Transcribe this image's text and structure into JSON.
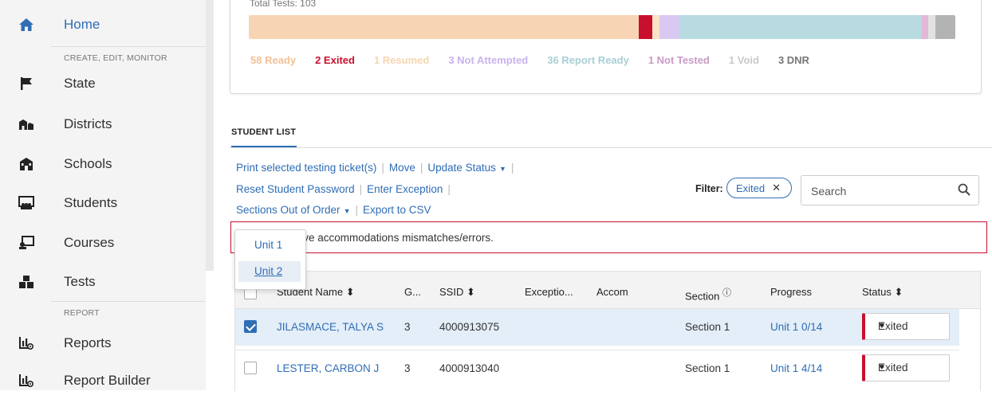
{
  "sidebar": {
    "items": [
      {
        "label": "Home",
        "icon": "home-icon"
      },
      {
        "label": "State",
        "icon": "flag-icon"
      },
      {
        "label": "Districts",
        "icon": "districts-icon"
      },
      {
        "label": "Schools",
        "icon": "school-icon"
      },
      {
        "label": "Students",
        "icon": "students-icon"
      },
      {
        "label": "Courses",
        "icon": "courses-icon"
      },
      {
        "label": "Tests",
        "icon": "tests-icon"
      },
      {
        "label": "Reports",
        "icon": "reports-icon"
      },
      {
        "label": "Report Builder",
        "icon": "report-builder-icon"
      }
    ],
    "sections": {
      "create": "CREATE, EDIT, MONITOR",
      "report": "REPORT"
    }
  },
  "summary": {
    "total_label": "Total Tests: 103",
    "segments": [
      {
        "label": "58 Ready",
        "count": 58,
        "color": "#f7d5b4"
      },
      {
        "label": "2 Exited",
        "count": 2,
        "color": "#c8102e"
      },
      {
        "label": "1 Resumed",
        "count": 1,
        "color": "#fbe3c6"
      },
      {
        "label": "3 Not Attempted",
        "count": 3,
        "color": "#d9c8f2"
      },
      {
        "label": "36 Report Ready",
        "count": 36,
        "color": "#b7dbe0"
      },
      {
        "label": "1 Not Tested",
        "count": 1,
        "color": "#e2b8d6"
      },
      {
        "label": "1 Void",
        "count": 1,
        "color": "#e2e2e2"
      },
      {
        "label": "3 DNR",
        "count": 3,
        "color": "#b3b3b3"
      }
    ],
    "legend_colors": [
      "#f2c196",
      "#c8102e",
      "#f5d6b0",
      "#c9b3ee",
      "#a8cfd5",
      "#c99bc6",
      "#c9c9c9",
      "#777777"
    ]
  },
  "tabs": {
    "student_list": "STUDENT LIST"
  },
  "actions": {
    "print": "Print selected testing ticket(s)",
    "move": "Move",
    "update_status": "Update Status",
    "reset_password": "Reset Student Password",
    "enter_exception": "Enter Exception",
    "sections_out_of_order": "Sections Out of Order",
    "export_csv": "Export to CSV",
    "separator": "|"
  },
  "filter": {
    "label": "Filter:",
    "chip": "Exited"
  },
  "search": {
    "placeholder": "Search"
  },
  "alert": {
    "text": ") have accommodations mismatches/errors."
  },
  "dropdown": {
    "items": [
      "Unit 1",
      "Unit 2"
    ],
    "selected": "Unit 2"
  },
  "table": {
    "headers": {
      "student_name": "Student Name",
      "grade": "G...",
      "ssid": "SSID",
      "exceptions": "Exceptio...",
      "accom": "Accom",
      "section": "Section",
      "progress": "Progress",
      "status": "Status"
    },
    "rows": [
      {
        "name": "JILASMACE, TALYA S",
        "grade": "3",
        "ssid": "4000913075",
        "section": "Section 1",
        "progress": "Unit 1 0/14",
        "status": "Exited",
        "checked": true
      },
      {
        "name": "LESTER, CARBON J",
        "grade": "3",
        "ssid": "4000913040",
        "section": "Section 1",
        "progress": "Unit 1 4/14",
        "status": "Exited",
        "checked": false
      }
    ]
  }
}
